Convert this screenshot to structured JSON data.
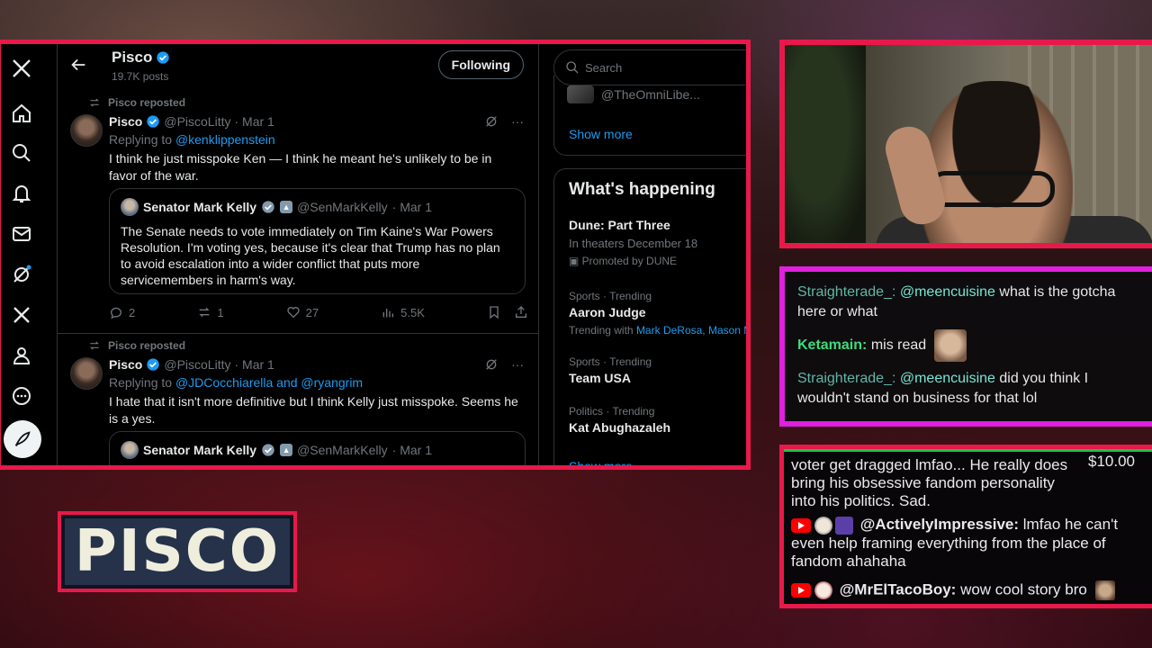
{
  "twitter": {
    "profile": {
      "name": "Pisco",
      "posts_count": "19.7K posts",
      "follow_label": "Following"
    },
    "posts": [
      {
        "repost_label": "Pisco reposted",
        "author_name": "Pisco",
        "author_handle": "@PiscoLitty",
        "date": "· Mar 1",
        "replying_prefix": "Replying to",
        "replying_to": "@kenklippenstein",
        "text": "I think he just misspoke Ken — I think he meant he's unlikely to be in favor of the war.",
        "quote": {
          "author_name": "Senator Mark Kelly",
          "author_handle": "@SenMarkKelly",
          "date": "· Mar 1",
          "text": "The Senate needs to vote immediately on Tim Kaine's War Powers Resolution. I'm voting yes, because it's clear that Trump has no plan to avoid escalation into a wider conflict that puts more servicemembers in harm's way."
        },
        "replies": "2",
        "reposts": "1",
        "likes": "27",
        "views": "5.5K"
      },
      {
        "repost_label": "Pisco reposted",
        "author_name": "Pisco",
        "author_handle": "@PiscoLitty",
        "date": "· Mar 1",
        "replying_prefix": "Replying to",
        "replying_to": "@JDCocchiarella and @ryangrim",
        "text": "I hate that it isn't more definitive but I think Kelly just misspoke. Seems he is a yes.",
        "quote": {
          "author_name": "Senator Mark Kelly",
          "author_handle": "@SenMarkKelly",
          "date": "· Mar 1"
        }
      }
    ],
    "sidebar": {
      "search_placeholder": "Search",
      "who_to_follow_handle": "@TheOmniLibe...",
      "show_more": "Show more",
      "whats_happening_title": "What's happening",
      "trends": [
        {
          "meta": "",
          "title": "Dune: Part Three",
          "sub": "In theaters December 18",
          "promo": "Promoted by DUNE"
        },
        {
          "meta": "Sports · Trending",
          "title": "Aaron Judge",
          "sub_prefix": "Trending with",
          "sub_links": "Mark DeRosa, Mason M"
        },
        {
          "meta": "Sports · Trending",
          "title": "Team USA"
        },
        {
          "meta": "Politics · Trending",
          "title": "Kat Abughazaleh"
        }
      ],
      "show_more_bottom": "Show more"
    },
    "nav_icons": [
      "x-logo-icon",
      "home-icon",
      "search-icon",
      "bell-icon",
      "mail-icon",
      "grok-icon",
      "x-premium-icon",
      "profile-icon",
      "more-icon"
    ]
  },
  "logo": {
    "text": "PISCO"
  },
  "twitch_chat": [
    {
      "user": "Straighterade_:",
      "mention": "@meencuisine",
      "text": "what is the gotcha here or what"
    },
    {
      "user": "Ketamain:",
      "text": "mis read"
    },
    {
      "user": "Straighterade_:",
      "mention": "@meencuisine",
      "text": "did you think I wouldn't stand on business for that lol"
    }
  ],
  "youtube_chat": {
    "superchat_text": "voter get dragged lmfao... He really does bring his obsessive fandom personality into his politics. Sad.",
    "superchat_amount": "$10.00",
    "messages": [
      {
        "user": "@ActivelyImpressive:",
        "text": "lmfao he can't even help framing everything from the place of fandom ahahaha"
      },
      {
        "user": "@MrElTacoBoy:",
        "text": "wow cool story bro"
      }
    ]
  },
  "colors": {
    "accent_red": "#e8194a",
    "accent_magenta": "#e020e0",
    "x_blue": "#1d9bf0",
    "superchat_green": "#17c44a"
  }
}
